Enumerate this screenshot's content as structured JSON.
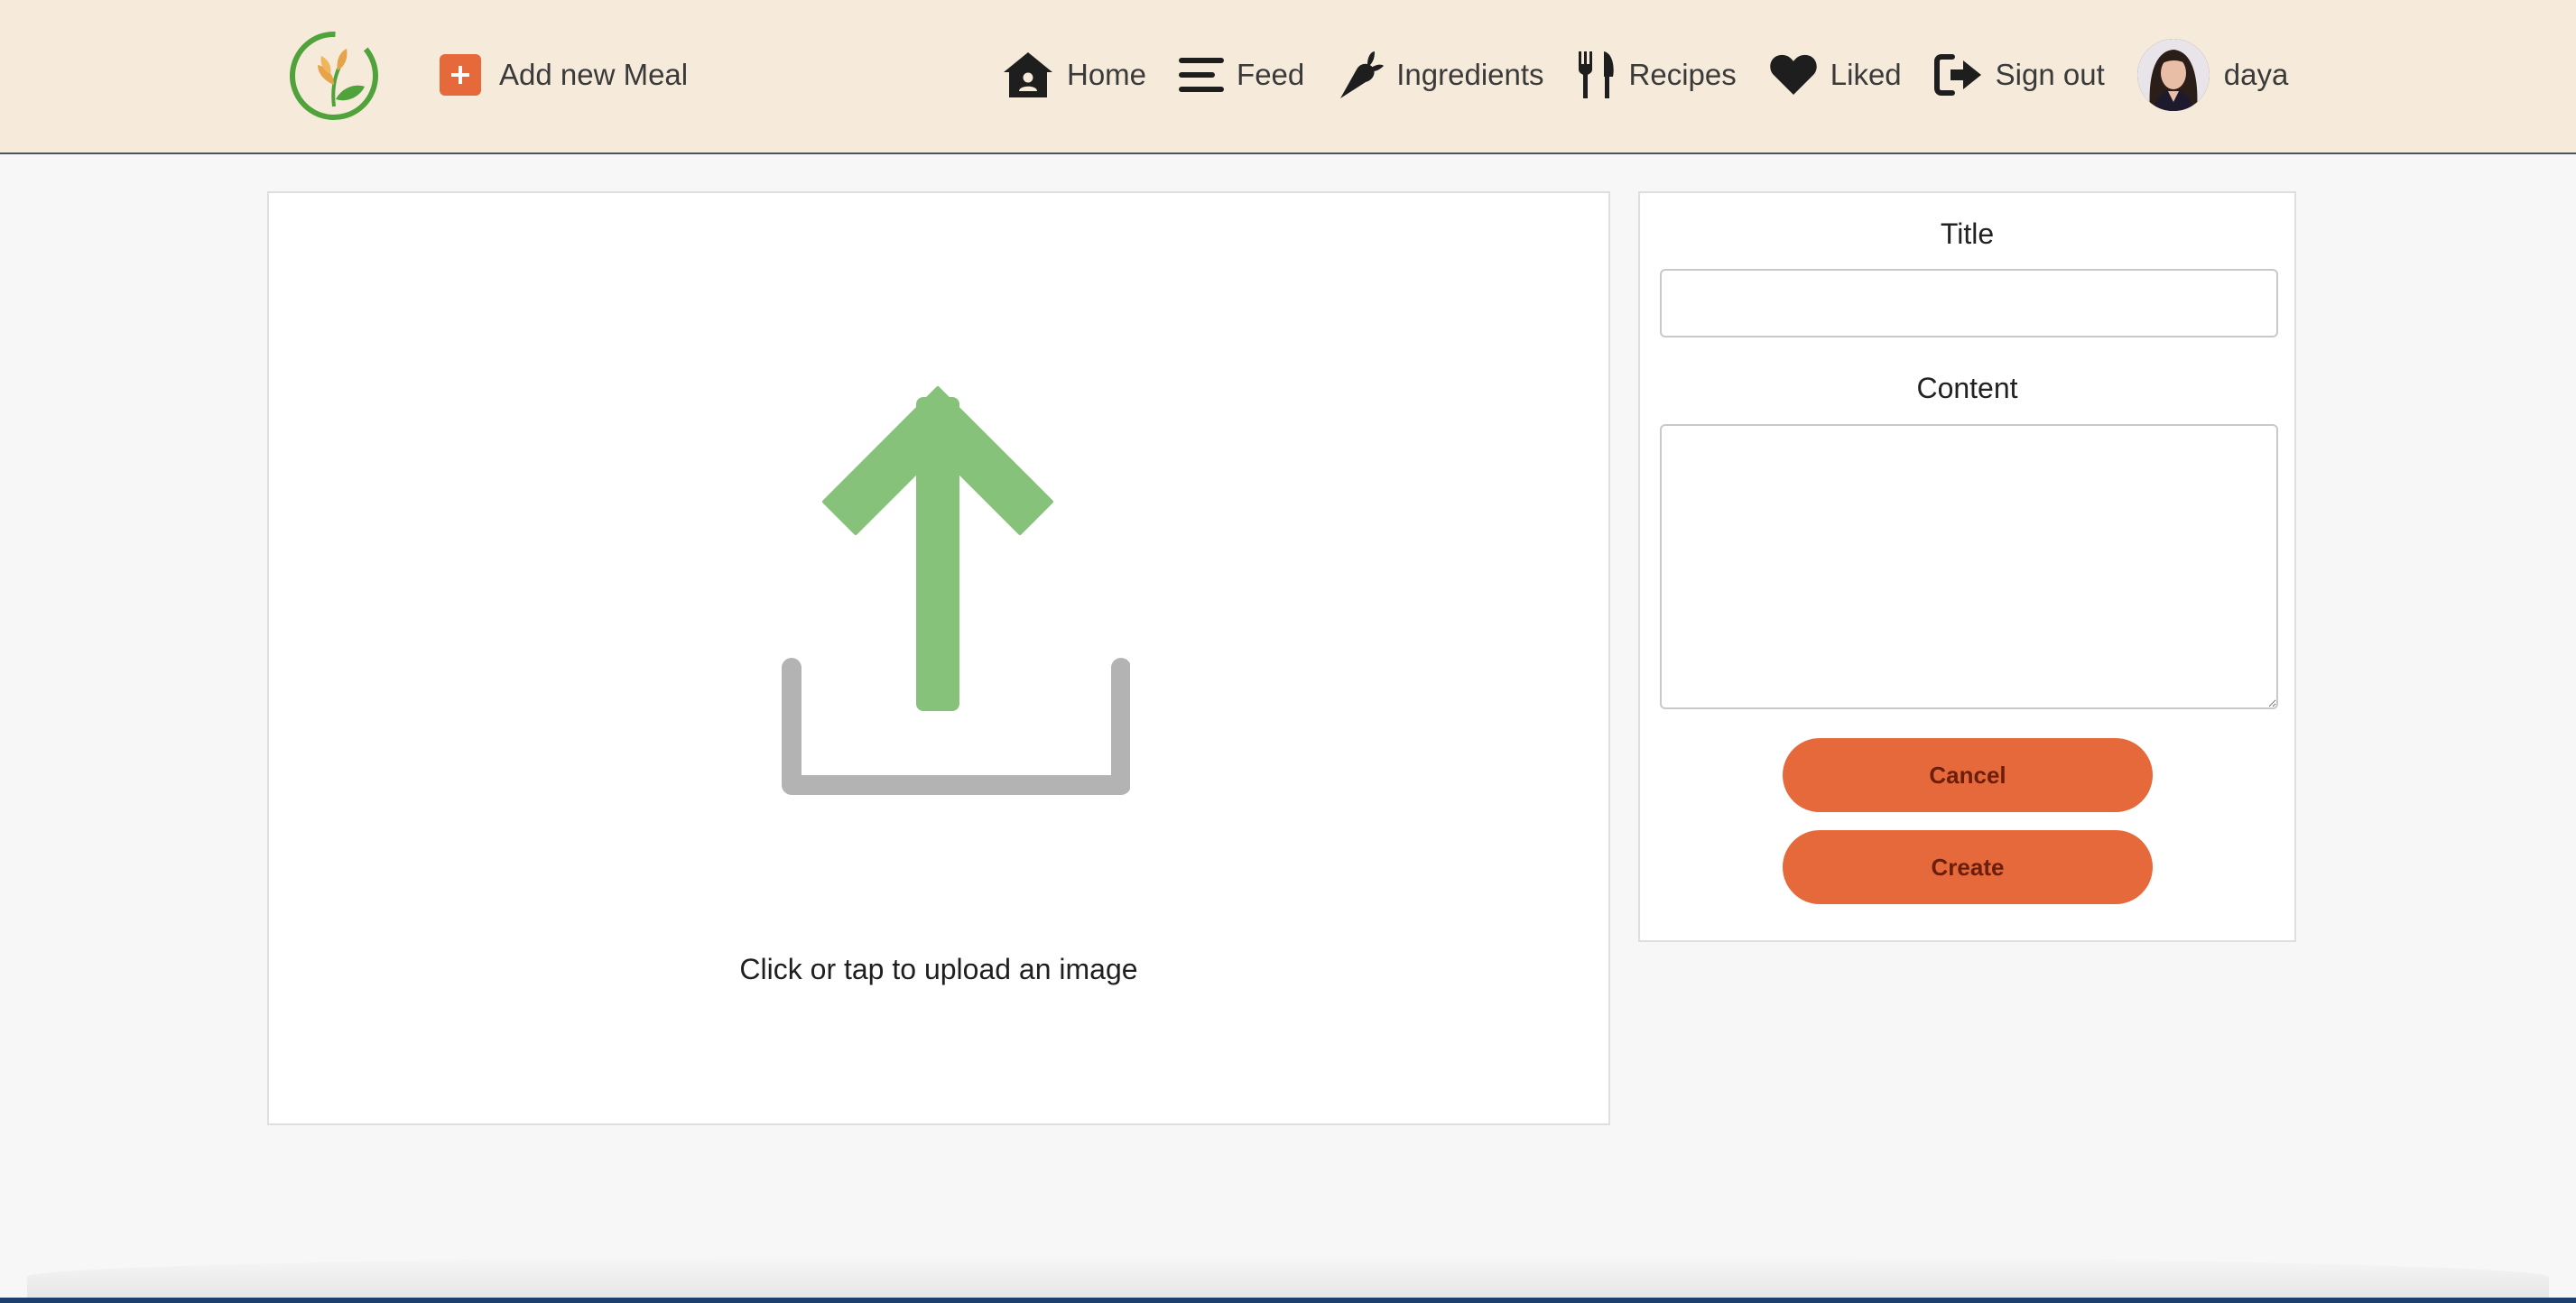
{
  "header": {
    "logo_name": "leaf-logo",
    "add_meal_label": "Add new Meal",
    "nav": [
      {
        "label": "Home",
        "icon": "home-icon"
      },
      {
        "label": "Feed",
        "icon": "menu-lines-icon"
      },
      {
        "label": "Ingredients",
        "icon": "carrot-icon"
      },
      {
        "label": "Recipes",
        "icon": "utensils-icon"
      },
      {
        "label": "Liked",
        "icon": "heart-icon"
      },
      {
        "label": "Sign out",
        "icon": "sign-out-icon"
      }
    ],
    "user": {
      "name": "daya"
    }
  },
  "upload": {
    "text": "Click or tap to upload an image"
  },
  "form": {
    "title_label": "Title",
    "title_value": "",
    "content_label": "Content",
    "content_value": "",
    "cancel_label": "Cancel",
    "create_label": "Create"
  },
  "colors": {
    "accent": "#e5693a",
    "header_bg": "#f6ebdb",
    "upload_arrow": "#86c27a",
    "upload_tray": "#b3b3b3"
  }
}
